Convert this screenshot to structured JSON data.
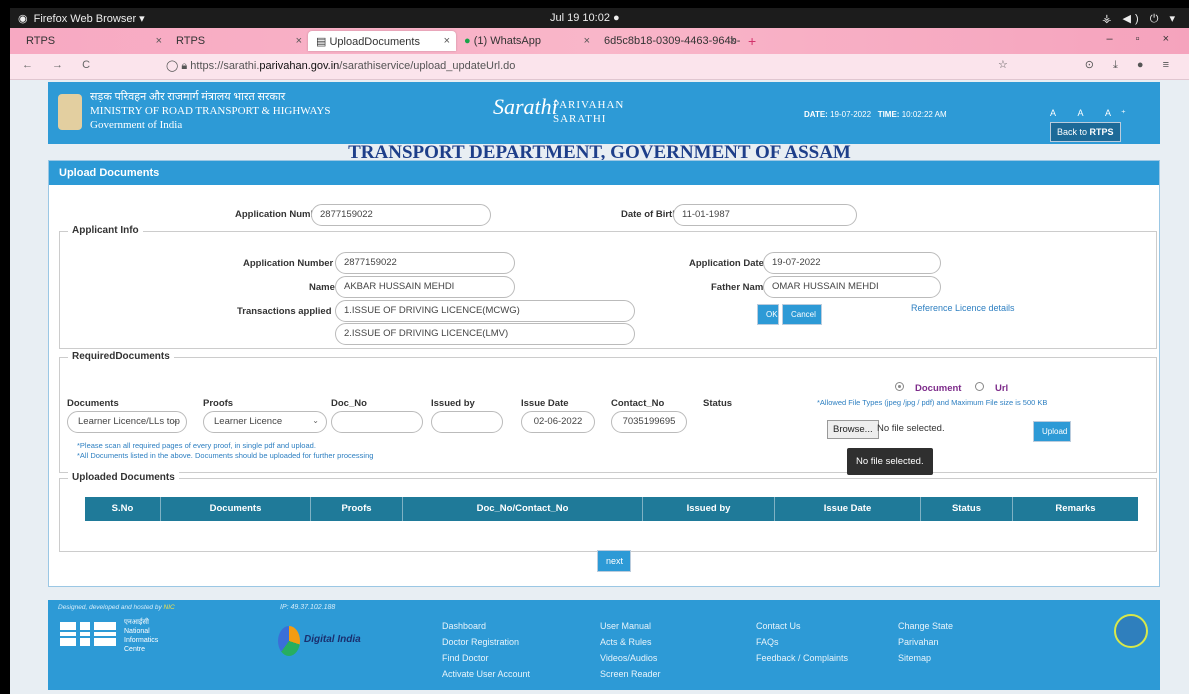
{
  "os_bar": {
    "left_label": "Firefox Web Browser ▾",
    "clock": "Jul 19  10:02  ●",
    "tray": "⚶ ◀) ⏻ ▾"
  },
  "browser": {
    "tabs": [
      {
        "label": "RTPS",
        "close": "×"
      },
      {
        "label": "RTPS",
        "close": "×"
      },
      {
        "label": "UploadDocuments",
        "close": "×"
      },
      {
        "label": "(1) WhatsApp",
        "close": "×"
      },
      {
        "label": "6d5c8b18-0309-4463-964b-",
        "close": "×"
      }
    ],
    "new_tab": "+",
    "window_controls": "– ▫ ×",
    "nav_buttons": "← → C",
    "url_prefix": "https://sarathi.",
    "url_domain": "parivahan.gov.in",
    "url_path": "/sarathiservice/upload_updateUrl.do"
  },
  "header": {
    "ministry_hindi": "सड़क परिवहन और राजमार्ग मंत्रालय भारत सरकार",
    "ministry_en": "MINISTRY OF ROAD TRANSPORT & HIGHWAYS",
    "govt": "Government of India",
    "logo_text": "Sarathi",
    "logo_sub1": "PARIVAHAN",
    "logo_sub2": "SARATHI",
    "date_label": "DATE:",
    "date_value": "19-07-2022",
    "time_label": "TIME:",
    "time_value": "10:02:22 AM",
    "font_sizes": "A A A⁺",
    "back_button_prefix": "Back to ",
    "back_button_bold": "RTPS"
  },
  "dept_title": "TRANSPORT DEPARTMENT, GOVERNMENT OF ASSAM",
  "panel_title": "Upload Documents",
  "top_row": {
    "app_no_label": "Application Number",
    "app_no_value": "2877159022",
    "dob_label": "Date of Birth",
    "dob_value": "11-01-1987"
  },
  "applicant": {
    "legend": "Applicant Info",
    "app_no_label": "Application Number",
    "app_no_value": "2877159022",
    "app_date_label": "Application Date",
    "app_date_value": "19-07-2022",
    "name_label": "Name",
    "name_value": "AKBAR HUSSAIN MEHDI",
    "father_label": "Father Name",
    "father_value": "OMAR HUSSAIN MEHDI",
    "trans_label": "Transactions applied",
    "trans_1": "1.ISSUE OF DRIVING LICENCE(MCWG)",
    "trans_2": "2.ISSUE OF DRIVING LICENCE(LMV)",
    "ok": "OK",
    "cancel": "Cancel",
    "ref_link": "Reference Licence details"
  },
  "required": {
    "legend": "RequiredDocuments",
    "radio_doc": "Document",
    "radio_url": "Url",
    "allowed_note": "*Allowed File Types (jpeg /jpg / pdf) and Maximum File size is 500 KB",
    "col_documents": "Documents",
    "col_proofs": "Proofs",
    "col_doc_no": "Doc_No",
    "col_issued_by": "Issued by",
    "col_issue_date": "Issue Date",
    "col_contact": "Contact_No",
    "col_status": "Status",
    "documents_value": "Learner Licence/LLs top",
    "proofs_value": "Learner Licence",
    "doc_no_value": "",
    "issued_by_value": "",
    "issue_date_value": "02-06-2022",
    "contact_value": "7035199695",
    "browse": "Browse...",
    "no_file": "No file selected.",
    "upload": "Upload",
    "tooltip": "No file selected.",
    "note1": "*Please scan all required pages of every proof, in single pdf and upload.",
    "note2": "*All Documents listed in the above. Documents should be uploaded for further processing"
  },
  "uploaded": {
    "legend": "Uploaded Documents",
    "columns": [
      "S.No",
      "Documents",
      "Proofs",
      "Doc_No/Contact_No",
      "Issued by",
      "Issue  Date",
      "Status",
      "Remarks"
    ]
  },
  "next_button": "next",
  "footer": {
    "designed": "Designed, developed and hosted by",
    "designed_link": "NIC",
    "ip": "IP: 49.37.102.188",
    "nic_hindi": "एनआईसी",
    "nic_1": "National",
    "nic_2": "Informatics",
    "nic_3": "Centre",
    "digital_india": "Digital India",
    "col1": [
      "Dashboard",
      "Doctor Registration",
      "Find Doctor",
      "Activate User Account"
    ],
    "col2": [
      "User Manual",
      "Acts & Rules",
      "Videos/Audios",
      "Screen Reader"
    ],
    "col3": [
      "Contact Us",
      "FAQs",
      "Feedback / Complaints"
    ],
    "col4": [
      "Change State",
      "Parivahan",
      "Sitemap"
    ]
  }
}
